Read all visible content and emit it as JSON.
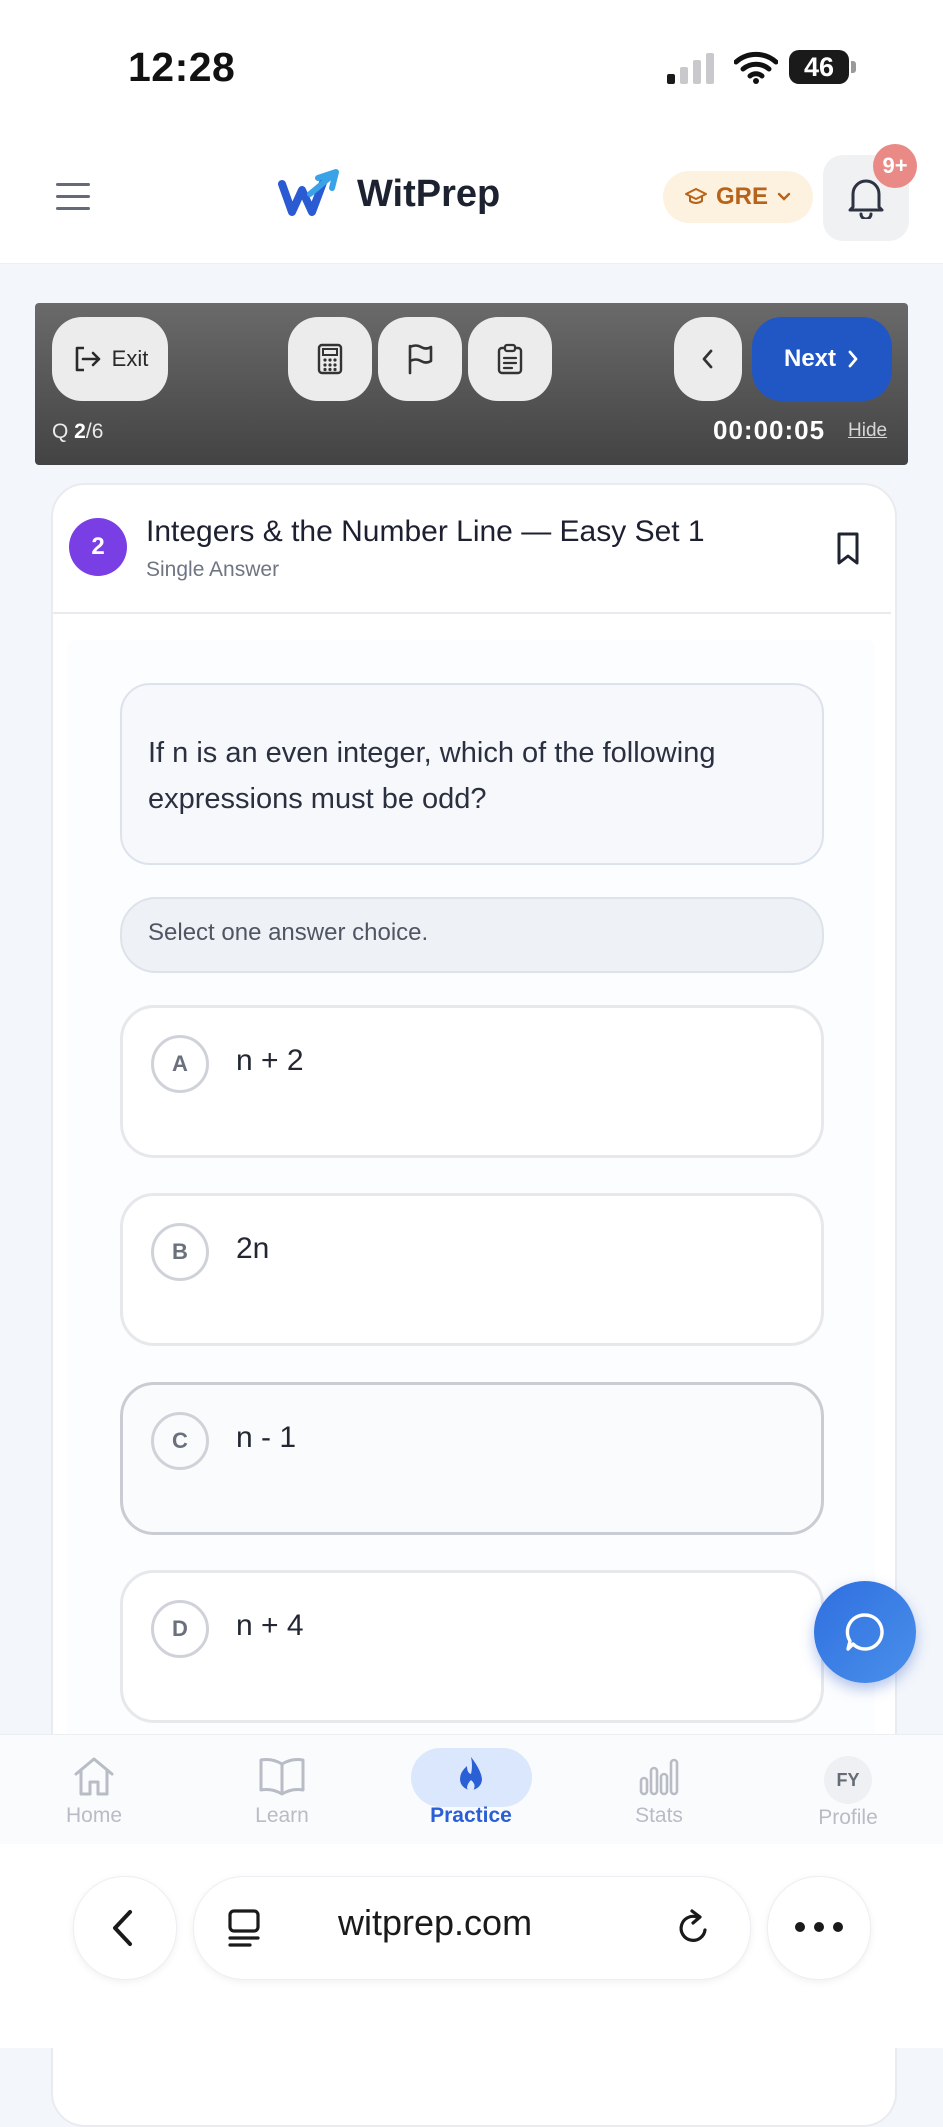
{
  "status_bar": {
    "time": "12:28",
    "battery": "46"
  },
  "header": {
    "brand": "WitPrep",
    "exam_selector": "GRE",
    "notification_count": "9+"
  },
  "toolbar": {
    "exit_label": "Exit",
    "next_label": "Next",
    "question_prefix": "Q ",
    "question_current": "2",
    "question_total": "/6",
    "timer": "00:00:05",
    "hide_label": "Hide"
  },
  "question": {
    "number": "2",
    "title": "Integers & the Number Line — Easy Set 1",
    "type": "Single Answer",
    "prompt": "If n is an even integer, which of the following expressions must be odd?",
    "instruction": "Select one answer choice.",
    "choices": [
      {
        "letter": "A",
        "text": "n + 2"
      },
      {
        "letter": "B",
        "text": "2n"
      },
      {
        "letter": "C",
        "text": "n - 1"
      },
      {
        "letter": "D",
        "text": "n + 4"
      }
    ]
  },
  "bottom_nav": {
    "items": [
      {
        "label": "Home"
      },
      {
        "label": "Learn"
      },
      {
        "label": "Practice"
      },
      {
        "label": "Stats"
      },
      {
        "label": "Profile",
        "avatar_initials": "FY"
      }
    ],
    "active": "Practice"
  },
  "browser": {
    "url": "witprep.com"
  },
  "colors": {
    "accent": "#2157c5",
    "question_badge": "#7a3fe4",
    "exam_chip_text": "#b8631a",
    "notification_badge": "#e98a86"
  }
}
